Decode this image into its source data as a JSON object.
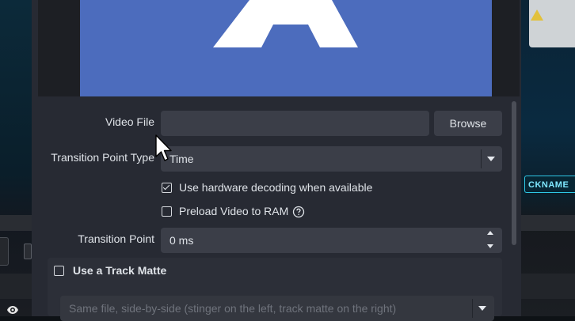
{
  "background": {
    "nickname_label": "CKNAME"
  },
  "preview": {
    "letter": "A",
    "color": "#4c6cbd"
  },
  "video_file": {
    "label": "Video File",
    "value": "",
    "browse_label": "Browse"
  },
  "transition_point_type": {
    "label": "Transition Point Type",
    "value": "Time"
  },
  "hardware_decoding": {
    "label": "Use hardware decoding when available",
    "checked": true
  },
  "preload_video": {
    "label": "Preload Video to RAM",
    "checked": false
  },
  "transition_point": {
    "label": "Transition Point",
    "value": "0 ms"
  },
  "track_matte": {
    "label": "Use a Track Matte",
    "checked": false,
    "layout_value": "Same file, side-by-side (stinger on the left, track matte on the right)"
  },
  "icons": {
    "help": "help-circle-icon",
    "eye": "eye-icon",
    "cursor": "mouse-pointer-icon",
    "dropdown": "chevron-down-icon",
    "spin_up": "caret-up-icon",
    "spin_down": "caret-down-icon"
  }
}
